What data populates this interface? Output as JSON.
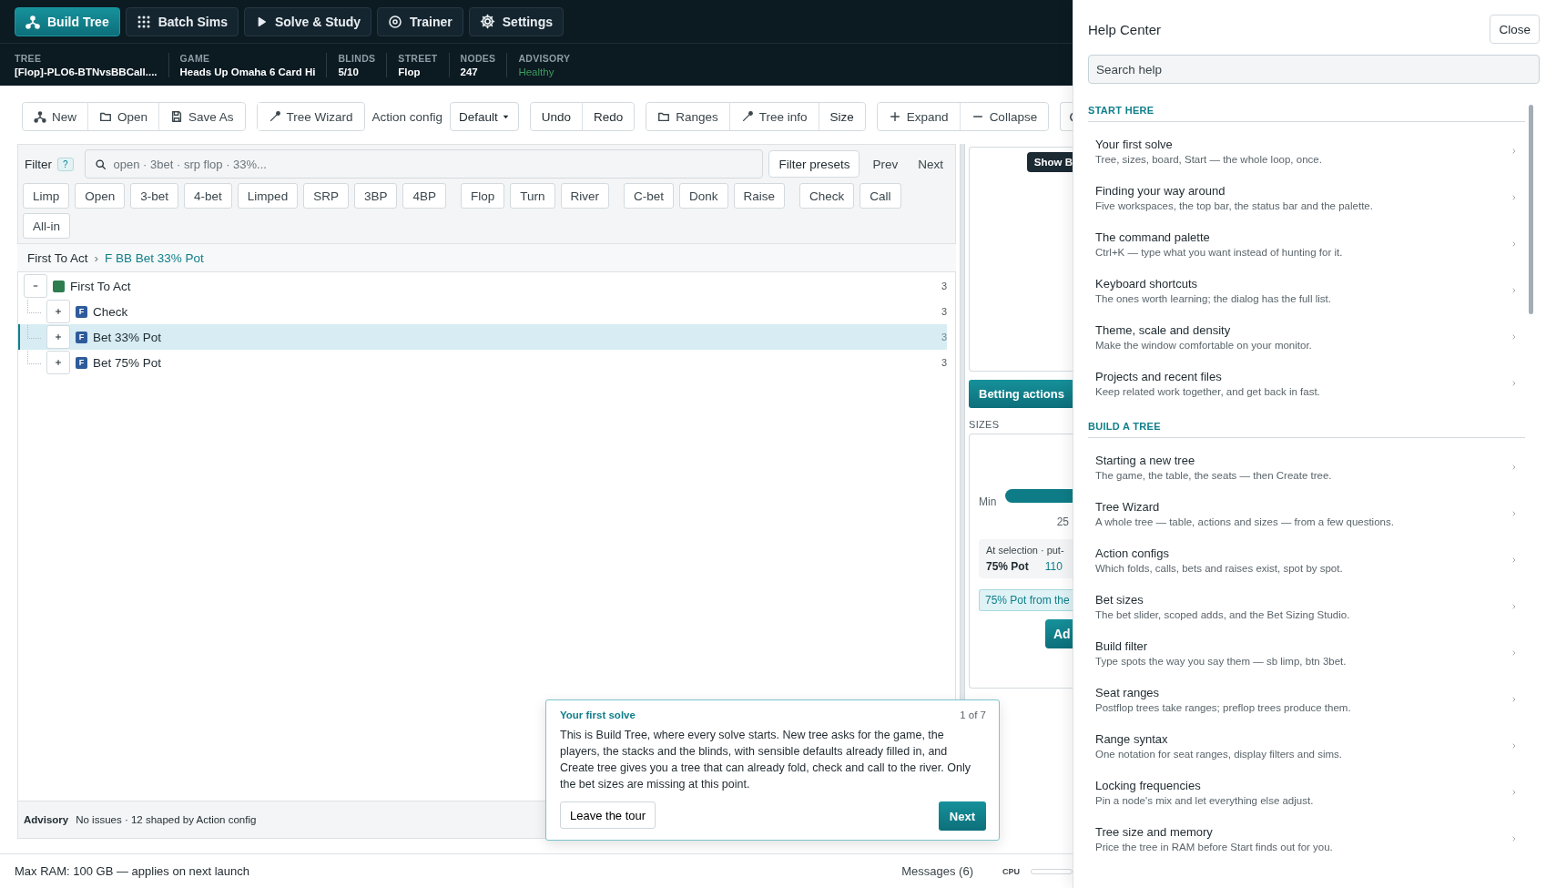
{
  "nav": {
    "tabs": [
      {
        "label": "Build Tree",
        "selected": true
      },
      {
        "label": "Batch Sims",
        "selected": false
      },
      {
        "label": "Solve & Study",
        "selected": false
      },
      {
        "label": "Trainer",
        "selected": false
      },
      {
        "label": "Settings",
        "selected": false
      }
    ]
  },
  "tree_status": [
    {
      "label": "TREE",
      "value": "[Flop]-PLO6-BTNvsBBCall....",
      "kind": "plain"
    },
    {
      "label": "GAME",
      "value": "Heads Up Omaha 6 Card Hi",
      "kind": "plain"
    },
    {
      "label": "BLINDS",
      "value": "5/10",
      "kind": "plain"
    },
    {
      "label": "STREET",
      "value": "Flop",
      "kind": "plain"
    },
    {
      "label": "NODES",
      "value": "247",
      "kind": "plain"
    },
    {
      "label": "ADVISORY",
      "value": "Healthy",
      "kind": "good"
    }
  ],
  "toolbar": [
    {
      "kind": "group",
      "buttons": [
        "New",
        "Open",
        "Save As"
      ]
    },
    {
      "kind": "group",
      "buttons": [
        "Tree Wizard"
      ]
    },
    {
      "kind": "label",
      "text": "Action config"
    },
    {
      "kind": "dropdown",
      "value": "Default"
    },
    {
      "kind": "group",
      "buttons": [
        "Undo",
        "Redo"
      ]
    },
    {
      "kind": "group",
      "buttons": [
        "Ranges",
        "Tree info",
        "Size"
      ]
    },
    {
      "kind": "group",
      "buttons": [
        "Expand",
        "Collapse"
      ]
    },
    {
      "kind": "refresh"
    }
  ],
  "filter": {
    "label": "Filter",
    "help": "?",
    "placeholder": "open · 3bet · srp flop · 33%...",
    "presets": "Filter presets",
    "prev": "Prev",
    "next": "Next",
    "chip_groups": [
      {
        "chips": [
          {
            "label": "Limp",
            "selected": false
          },
          {
            "label": "Open",
            "selected": false
          },
          {
            "label": "3-bet",
            "selected": false
          },
          {
            "label": "4-bet",
            "selected": false
          },
          {
            "label": "Limped",
            "selected": false
          },
          {
            "label": "SRP",
            "selected": false
          },
          {
            "label": "3BP",
            "selected": false
          },
          {
            "label": "4BP",
            "selected": false
          }
        ]
      },
      {
        "chips": [
          {
            "label": "Flop",
            "selected": false
          },
          {
            "label": "Turn",
            "selected": false
          },
          {
            "label": "River",
            "selected": false
          }
        ]
      },
      {
        "chips": [
          {
            "label": "C-bet",
            "selected": false
          },
          {
            "label": "Donk",
            "selected": false
          },
          {
            "label": "Raise",
            "selected": false
          }
        ]
      },
      {
        "chips": [
          {
            "label": "Check",
            "selected": false
          },
          {
            "label": "Call",
            "selected": false
          }
        ]
      },
      {
        "chips": [
          {
            "label": "All-in",
            "selected": false
          }
        ]
      }
    ]
  },
  "breadcrumb": {
    "separator": "›",
    "crumbs": [
      {
        "label": "First To Act",
        "selected": false
      },
      {
        "label": "F BB Bet 33% Pot",
        "selected": true
      }
    ]
  },
  "tree": [
    {
      "label": "First To Act",
      "count": "3",
      "color": "#2e7d4f",
      "expanded": true,
      "selected": false,
      "children": [
        {
          "label": "Check",
          "badge": "F",
          "count": "3",
          "expanded": false,
          "selected": false
        },
        {
          "label": "Bet 33% Pot",
          "badge": "F",
          "count": "3",
          "expanded": false,
          "selected": true
        },
        {
          "label": "Bet 75% Pot",
          "badge": "F",
          "count": "3",
          "expanded": false,
          "selected": false
        }
      ]
    }
  ],
  "advisory": {
    "label": "Advisory",
    "text": "No issues · 12 shaped by Action config"
  },
  "side": {
    "show_button": "Show B",
    "tab": "Betting actions",
    "sizes_label": "SIZES",
    "min": "Min",
    "tick": "25",
    "selection_caption": "At selection · put-",
    "selection_size": "75% Pot",
    "selection_value": "110",
    "hint": "75% Pot from the",
    "add": "Ad"
  },
  "tour": {
    "title": "Your first solve",
    "step": "1 of 7",
    "body": "This is Build Tree, where every solve starts. New tree asks for the game, the players, the stacks and the blinds, with sensible defaults already filled in, and Create tree gives you a tree that can already fold, check and call to the river. Only the bet sizes are missing at this point.",
    "leave": "Leave the tour",
    "next": "Next"
  },
  "status_bar": {
    "ram": "Max RAM: 100 GB — applies on next launch",
    "messages": "Messages (6)",
    "cpu": "CPU",
    "cpu_meter": {
      "level": 0
    }
  },
  "help": {
    "title": "Help Center",
    "close": "Close",
    "placeholder": "Search help",
    "sections": [
      {
        "title": "START HERE",
        "items": [
          {
            "title": "Your first solve",
            "desc": "Tree, sizes, board, Start — the whole loop, once."
          },
          {
            "title": "Finding your way around",
            "desc": "Five workspaces, the top bar, the status bar and the palette."
          },
          {
            "title": "The command palette",
            "desc": "Ctrl+K — type what you want instead of hunting for it."
          },
          {
            "title": "Keyboard shortcuts",
            "desc": "The ones worth learning; the dialog has the full list."
          },
          {
            "title": "Theme, scale and density",
            "desc": "Make the window comfortable on your monitor."
          },
          {
            "title": "Projects and recent files",
            "desc": "Keep related work together, and get back in fast."
          }
        ]
      },
      {
        "title": "BUILD A TREE",
        "items": [
          {
            "title": "Starting a new tree",
            "desc": "The game, the table, the seats — then Create tree."
          },
          {
            "title": "Tree Wizard",
            "desc": "A whole tree — table, actions and sizes — from a few questions."
          },
          {
            "title": "Action configs",
            "desc": "Which folds, calls, bets and raises exist, spot by spot."
          },
          {
            "title": "Bet sizes",
            "desc": "The bet slider, scoped adds, and the Bet Sizing Studio."
          },
          {
            "title": "Build filter",
            "desc": "Type spots the way you say them — sb limp, btn 3bet."
          },
          {
            "title": "Seat ranges",
            "desc": "Postflop trees take ranges; preflop trees produce them."
          },
          {
            "title": "Range syntax",
            "desc": "One notation for seat ranges, display filters and sims."
          },
          {
            "title": "Locking frequencies",
            "desc": "Pin a node's mix and let everything else adjust."
          },
          {
            "title": "Tree size and memory",
            "desc": "Price the tree in RAM before Start finds out for you."
          }
        ]
      }
    ]
  }
}
